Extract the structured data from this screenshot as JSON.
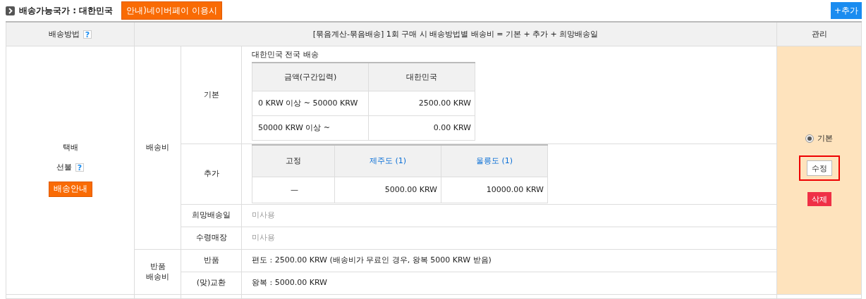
{
  "section": {
    "title": "배송가능국가 : 대한민국",
    "naver_button": "안내)네이버페이 이용시",
    "add_button": "+추가"
  },
  "table": {
    "columns": [
      {
        "label": "배송방법",
        "help": "?"
      },
      {
        "label": "[묶음계산-묶음배송] 1회 구매 시 배송방법별 배송비 = 기본 + 추가 + 희망배송일"
      },
      {
        "label": "관리"
      }
    ],
    "method": {
      "name": "택배",
      "payment": "선불",
      "help": "?",
      "guide_button": "배송안내"
    },
    "fee_group": "배송비",
    "basic": {
      "label": "기본",
      "caption": "대한민국 전국 배송",
      "headers": [
        "금액(구간입력)",
        "대한민국"
      ],
      "rows": [
        [
          "0 KRW 이상 ~ 50000 KRW",
          "2500.00 KRW"
        ],
        [
          "50000 KRW 이상 ~",
          "0.00 KRW"
        ]
      ]
    },
    "extra": {
      "label": "추가",
      "headers": [
        {
          "text": "고정",
          "link": false
        },
        {
          "text": "제주도 (1)",
          "link": true
        },
        {
          "text": "울릉도 (1)",
          "link": true
        }
      ],
      "row": [
        "—",
        "5000.00 KRW",
        "10000.00 KRW"
      ]
    },
    "options": [
      {
        "label": "희망배송일",
        "value": "미사용"
      },
      {
        "label": "수령매장",
        "value": "미사용"
      }
    ],
    "return_group": [
      "반품",
      "배송비"
    ],
    "returns": [
      {
        "label": "반품",
        "value": "편도 : 2500.00 KRW (배송비가 무료인 경우, 왕복 5000 KRW 받음)"
      },
      {
        "label": "(맞)교환",
        "value": "왕복 : 5000.00 KRW"
      }
    ],
    "manage": {
      "radio": {
        "label": "기본",
        "selected": true
      },
      "edit_button": "수정",
      "delete_button": "삭제",
      "highlighted": true
    }
  }
}
